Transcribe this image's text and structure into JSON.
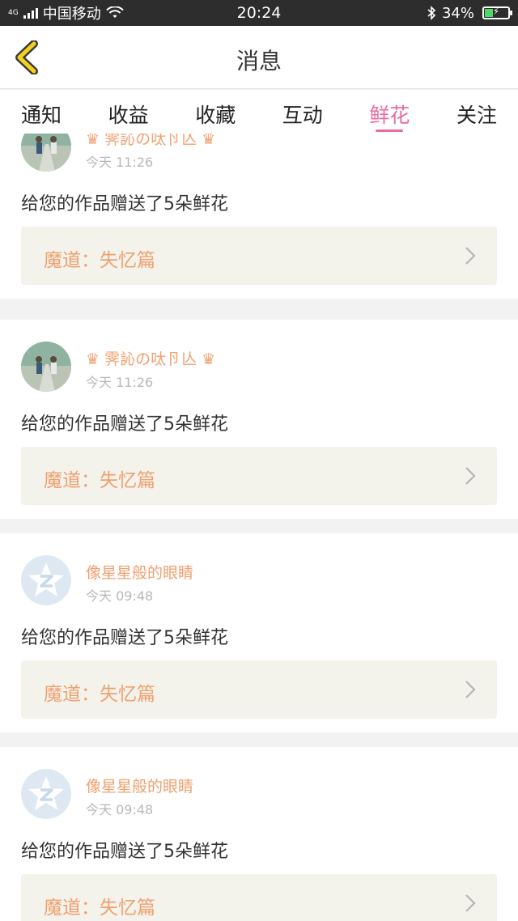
{
  "status_bar": {
    "network_tag": "4G",
    "carrier": "中国移动",
    "time": "20:24",
    "battery_percent": "34%",
    "battery_level": 0.34,
    "bluetooth_icon": "bluetooth-icon",
    "wifi_icon": "wifi-icon"
  },
  "header": {
    "title": "消息",
    "back_icon": "back-chevron-icon",
    "accent_color": "#f5d020"
  },
  "tabs": [
    {
      "label": "通知",
      "active": false
    },
    {
      "label": "收益",
      "active": false
    },
    {
      "label": "收藏",
      "active": false
    },
    {
      "label": "互动",
      "active": false
    },
    {
      "label": "鲜花",
      "active": true
    },
    {
      "label": "关注",
      "active": false
    }
  ],
  "colors": {
    "active_tab": "#e96ba3",
    "username": "#f0a070",
    "work_title": "#f0a070"
  },
  "messages": [
    {
      "username": "♛ 霁訫の呔卪亾 ♛",
      "time": "今天 11:26",
      "text": "给您的作品赠送了5朵鲜花",
      "work_title": "魔道：失忆篇",
      "avatar": "photo-avatar"
    },
    {
      "username": "♛ 霁訫の呔卪亾 ♛",
      "time": "今天 11:26",
      "text": "给您的作品赠送了5朵鲜花",
      "work_title": "魔道：失忆篇",
      "avatar": "photo-avatar"
    },
    {
      "username": "像星星般的眼睛",
      "time": "今天 09:48",
      "text": "给您的作品赠送了5朵鲜花",
      "work_title": "魔道：失忆篇",
      "avatar": "default-avatar"
    },
    {
      "username": "像星星般的眼睛",
      "time": "今天 09:48",
      "text": "给您的作品赠送了5朵鲜花",
      "work_title": "魔道：失忆篇",
      "avatar": "default-avatar"
    }
  ]
}
